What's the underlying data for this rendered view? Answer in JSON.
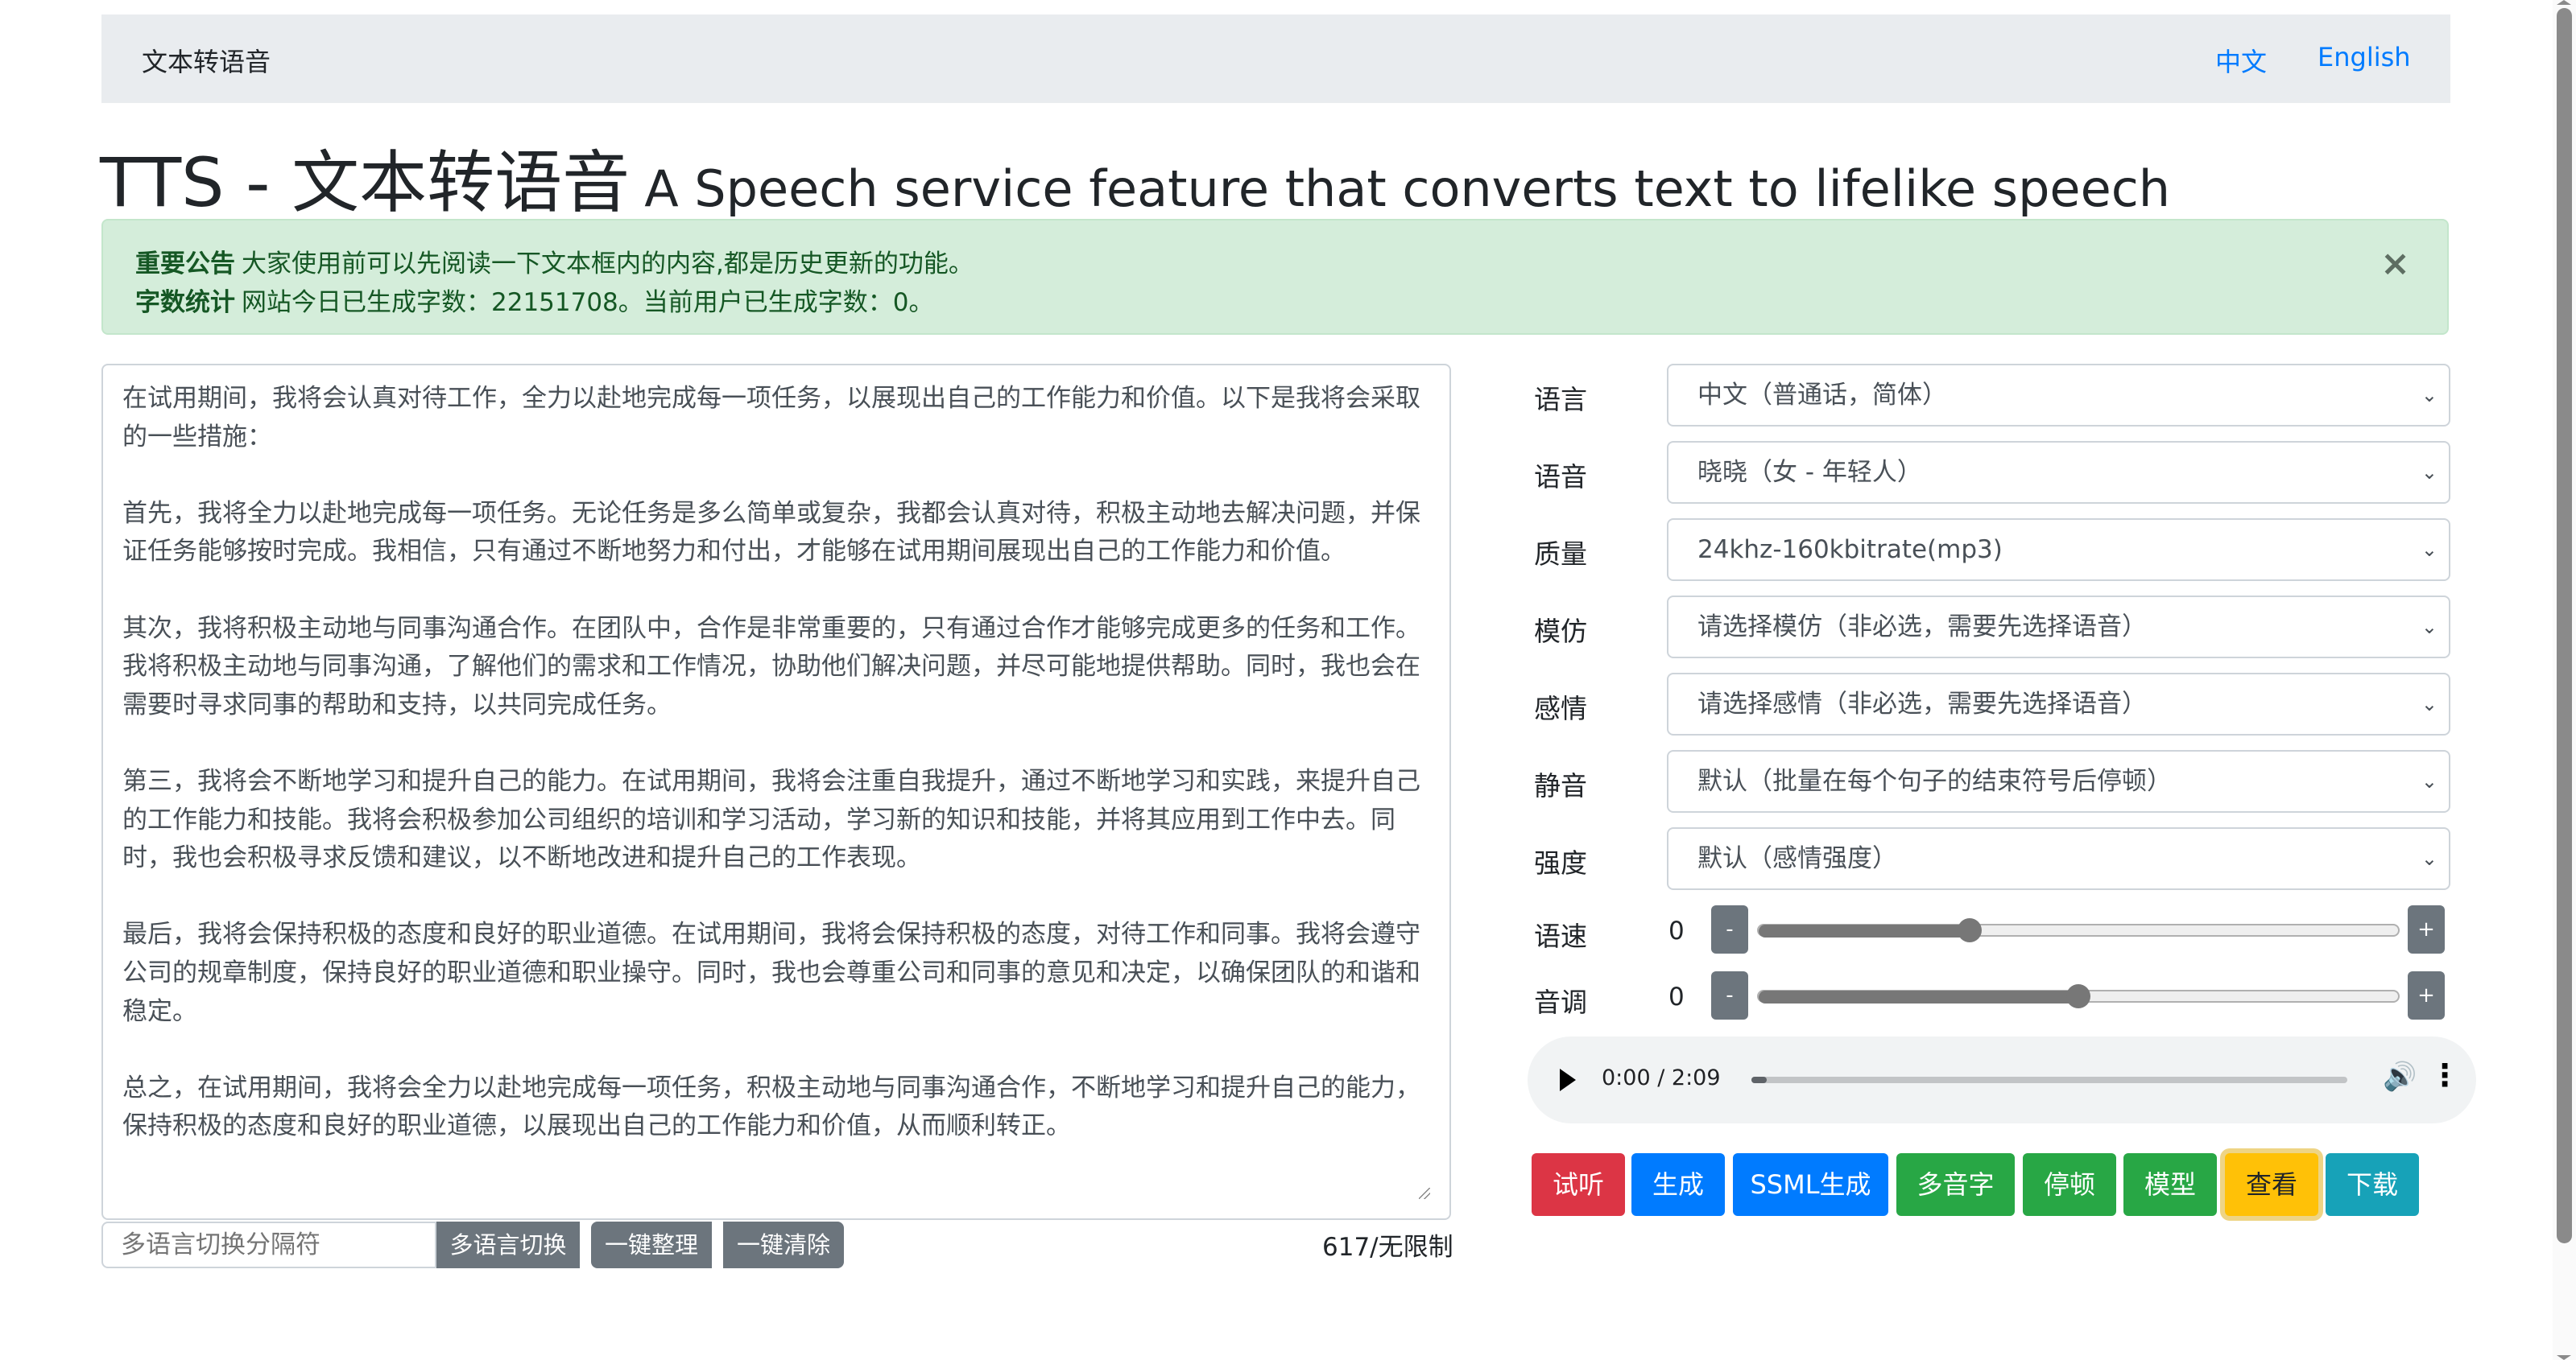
{
  "navbar": {
    "brand": "文本转语音",
    "links": [
      {
        "label": "中文"
      },
      {
        "label": "English"
      }
    ]
  },
  "title": {
    "main": "TTS - 文本转语音",
    "subtitle": "A Speech service feature that converts text to lifelike speech"
  },
  "alert": {
    "notice_label": "重要公告",
    "notice_text": "大家使用前可以先阅读一下文本框内的内容,都是历史更新的功能。",
    "stats_label": "字数统计",
    "stats_text": "网站今日已生成字数：22151708。当前用户已生成字数：0。",
    "close_icon": "×"
  },
  "editor": {
    "text": "在试用期间，我将会认真对待工作，全力以赴地完成每一项任务，以展现出自己的工作能力和价值。以下是我将会采取的一些措施：\n\n首先，我将全力以赴地完成每一项任务。无论任务是多么简单或复杂，我都会认真对待，积极主动地去解决问题，并保证任务能够按时完成。我相信，只有通过不断地努力和付出，才能够在试用期间展现出自己的工作能力和价值。\n\n其次，我将积极主动地与同事沟通合作。在团队中，合作是非常重要的，只有通过合作才能够完成更多的任务和工作。我将积极主动地与同事沟通，了解他们的需求和工作情况，协助他们解决问题，并尽可能地提供帮助。同时，我也会在需要时寻求同事的帮助和支持，以共同完成任务。\n\n第三，我将会不断地学习和提升自己的能力。在试用期间，我将会注重自我提升，通过不断地学习和实践，来提升自己的工作能力和技能。我将会积极参加公司组织的培训和学习活动，学习新的知识和技能，并将其应用到工作中去。同时，我也会积极寻求反馈和建议，以不断地改进和提升自己的工作表现。\n\n最后，我将会保持积极的态度和良好的职业道德。在试用期间，我将会保持积极的态度，对待工作和同事。我将会遵守公司的规章制度，保持良好的职业道德和职业操守。同时，我也会尊重公司和同事的意见和决定，以确保团队的和谐和稳定。\n\n总之，在试用期间，我将会全力以赴地完成每一项任务，积极主动地与同事沟通合作，不断地学习和提升自己的能力，保持积极的态度和良好的职业道德，以展现出自己的工作能力和价值，从而顺利转正。",
    "separator_placeholder": "多语言切换分隔符",
    "multi_lang_button": "多语言切换",
    "tidy_button": "一键整理",
    "clear_button": "一键清除",
    "char_count": "617/无限制"
  },
  "settings": {
    "language": {
      "label": "语言",
      "value": "中文（普通话，简体）"
    },
    "voice": {
      "label": "语音",
      "value": "晓晓（女 - 年轻人）"
    },
    "quality": {
      "label": "质量",
      "value": "24khz-160kbitrate(mp3)"
    },
    "imitate": {
      "label": "模仿",
      "value": "请选择模仿（非必选，需要先选择语音）"
    },
    "emotion": {
      "label": "感情",
      "value": "请选择感情（非必选，需要先选择语音）"
    },
    "silence": {
      "label": "静音",
      "value": "默认（批量在每个句子的结束符号后停顿）"
    },
    "intensity": {
      "label": "强度",
      "value": "默认（感情强度）"
    },
    "rate": {
      "label": "语速",
      "value": "0",
      "slider_fraction": 0.33
    },
    "pitch": {
      "label": "音调",
      "value": "0",
      "slider_fraction": 0.5
    },
    "minus_label": "-",
    "plus_label": "+",
    "chevron_icon": "⌄"
  },
  "audio": {
    "time": "0:00 / 2:09",
    "progress_fraction": 0.0,
    "volume_icon": "🔊",
    "more_icon": "⋮"
  },
  "actions": [
    {
      "label": "试听",
      "color": "#dc3545",
      "text_color": "#ffffff"
    },
    {
      "label": "生成",
      "color": "#007bff",
      "text_color": "#ffffff"
    },
    {
      "label": "SSML生成",
      "color": "#007bff",
      "text_color": "#ffffff"
    },
    {
      "label": "多音字",
      "color": "#28a745",
      "text_color": "#ffffff"
    },
    {
      "label": "停顿",
      "color": "#28a745",
      "text_color": "#ffffff"
    },
    {
      "label": "模型",
      "color": "#28a745",
      "text_color": "#ffffff"
    },
    {
      "label": "查看",
      "color": "#ffc107",
      "text_color": "#212529"
    },
    {
      "label": "下载",
      "color": "#17a2b8",
      "text_color": "#ffffff"
    }
  ]
}
